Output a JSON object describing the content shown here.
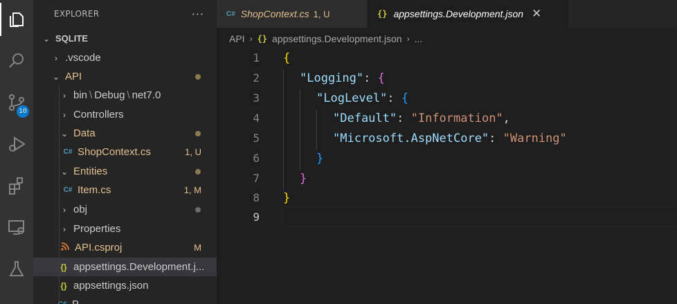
{
  "activity_bar": {
    "icons": [
      "explorer-icon",
      "search-icon",
      "source-control-icon",
      "run-debug-icon",
      "extensions-icon",
      "remote-explorer-icon",
      "testing-icon"
    ],
    "source_control_badge": "10",
    "accent": "#007acc"
  },
  "sidebar": {
    "title": "EXPLORER",
    "more": "···",
    "root": "SQLITE",
    "items": [
      {
        "label": ".vscode",
        "type": "folder",
        "expanded": false,
        "status": ""
      },
      {
        "label": "API",
        "type": "folder",
        "expanded": true,
        "status": "dot"
      },
      {
        "label": "bin",
        "label2": "Debug",
        "label3": "net7.0",
        "type": "folder",
        "expanded": false,
        "status": ""
      },
      {
        "label": "Controllers",
        "type": "folder",
        "expanded": false,
        "status": ""
      },
      {
        "label": "Data",
        "type": "folder",
        "expanded": true,
        "status": "dot"
      },
      {
        "label": "ShopContext.cs",
        "type": "csharp",
        "status": "1, U"
      },
      {
        "label": "Entities",
        "type": "folder",
        "expanded": true,
        "status": "dot"
      },
      {
        "label": "Item.cs",
        "type": "csharp",
        "status": "1, M"
      },
      {
        "label": "obj",
        "type": "folder",
        "expanded": false,
        "status": "dot"
      },
      {
        "label": "Properties",
        "type": "folder",
        "expanded": false,
        "status": ""
      },
      {
        "label": "API.csproj",
        "type": "rss",
        "status": "M"
      },
      {
        "label": "appsettings.Development.j...",
        "type": "json",
        "status": "",
        "selected": true
      },
      {
        "label": "appsettings.json",
        "type": "json",
        "status": ""
      },
      {
        "label": "P",
        "type": "csharp",
        "status": ""
      }
    ],
    "chev_right": "›",
    "chev_down": "⌄",
    "csharp_glyph": "C#",
    "json_glyph": "{}",
    "path_sep": "\\"
  },
  "tabs": [
    {
      "label": "ShopContext.cs",
      "status": "1, U",
      "active": false
    },
    {
      "label": "appsettings.Development.json",
      "status": "",
      "active": true,
      "close": "✕"
    }
  ],
  "breadcrumb": {
    "parts": [
      "API",
      "appsettings.Development.json",
      "..."
    ],
    "sep": "›"
  },
  "editor": {
    "line_numbers": [
      "1",
      "2",
      "3",
      "4",
      "5",
      "6",
      "7",
      "8",
      "9"
    ],
    "current_line": 9,
    "lines": {
      "l1": "{",
      "l2_key": "\"Logging\"",
      "l2_colon": ": ",
      "l2_brace": "{",
      "l3_key": "\"LogLevel\"",
      "l3_colon": ": ",
      "l3_brace": "{",
      "l4_key": "\"Default\"",
      "l4_colon": ": ",
      "l4_val": "\"Information\"",
      "l4_comma": ",",
      "l5_key": "\"Microsoft.AspNetCore\"",
      "l5_colon": ": ",
      "l5_val": "\"Warning\"",
      "l6": "}",
      "l7": "}",
      "l8": "}"
    }
  },
  "colors": {
    "modified": "#e2c08d",
    "bracket1": "#ffd700",
    "bracket2": "#da70d6",
    "bracket3": "#179fff",
    "json_key": "#9cdcfe",
    "json_string": "#ce9178"
  }
}
